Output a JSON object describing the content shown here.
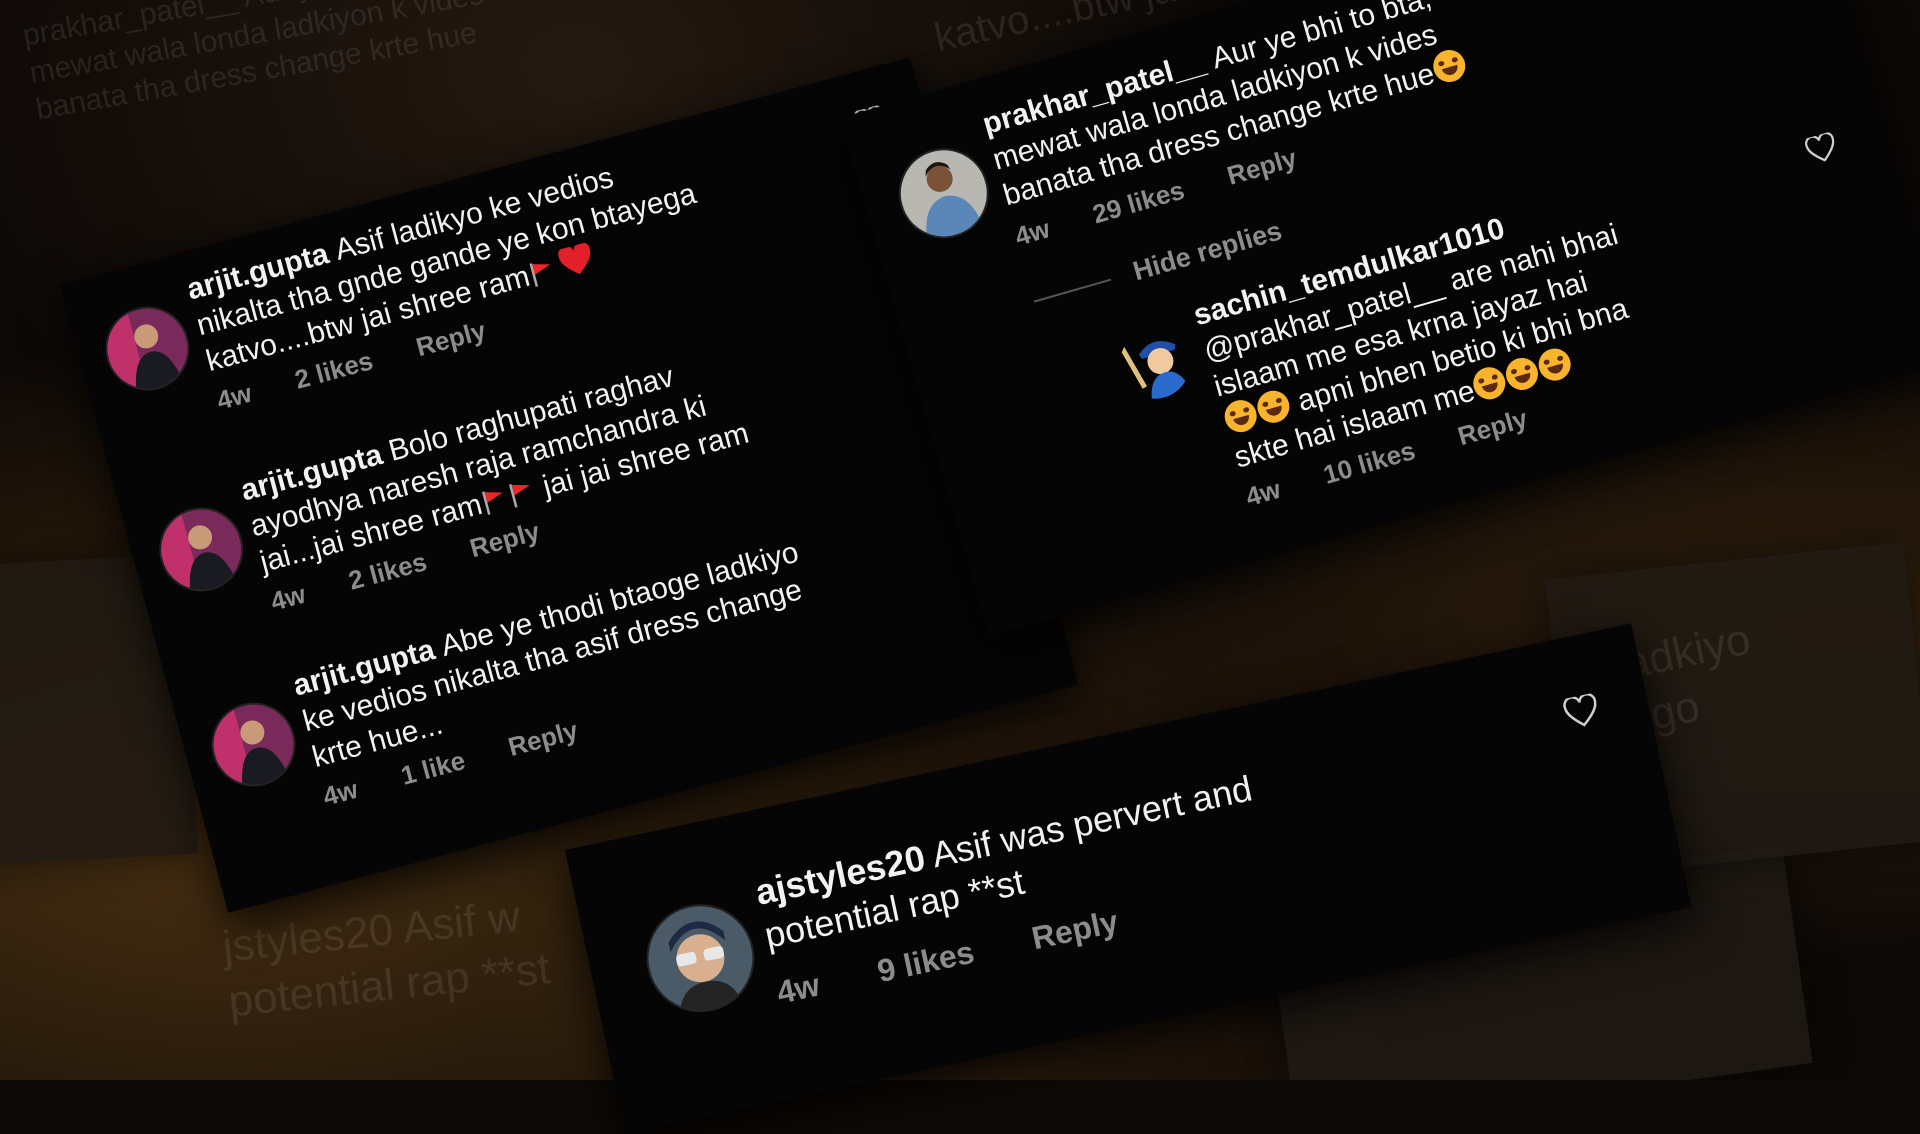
{
  "background": {
    "ghost_lines": [
      "prakhar_patel__ Aur ye bhi to bta,",
      "mewat wala londa ladkiyon k vides",
      "banata tha dress change krte hue",
      "katvo....btw jai shree ram",
      "ladkiyo",
      "ngo",
      "jstyles20 Asif w",
      "potential rap **st"
    ]
  },
  "colors": {
    "panel_bg": "#050505",
    "text": "#f2f2f2",
    "meta": "#8c8c8c",
    "flag_red": "#e8282b",
    "heart_red": "#e3202a",
    "emoji_yellow": "#f7b42c"
  },
  "panel_left": {
    "comments": [
      {
        "username": "arjit.gupta",
        "lines": [
          "Asif ladikyo ke vedios",
          "nikalta tha gnde gande ye kon btayega",
          "katvo....btw jai shree ram"
        ],
        "trailing_emoji": [
          "red-flag",
          "red-heart"
        ],
        "time": "4w",
        "likes": "2 likes",
        "reply": "Reply",
        "avatar_icon": "avatar-photo"
      },
      {
        "username": "arjit.gupta",
        "lines": [
          "Bolo raghupati raghav",
          "ayodhya naresh raja ramchandra ki",
          "jai...jai shree ram",
          "jai jai shree ram"
        ],
        "time": "4w",
        "likes": "2 likes",
        "reply": "Reply",
        "avatar_icon": "avatar-photo"
      },
      {
        "username": "arjit.gupta",
        "lines": [
          "Abe ye thodi btaoge ladkiyo",
          "ke vedios nikalta tha asif dress change",
          "krte hue..."
        ],
        "time": "4w",
        "likes": "1 like",
        "reply": "Reply",
        "avatar_icon": "avatar-photo"
      }
    ]
  },
  "panel_right": {
    "comment": {
      "username": "prakhar_patel__",
      "lines": [
        "Aur ye bhi to bta,",
        "mewat wala londa ladkiyon k vides",
        "banata tha dress change krte hue"
      ],
      "trailing_emoji": [
        "face-with-tears-of-joy"
      ],
      "time": "4w",
      "likes": "29 likes",
      "reply": "Reply"
    },
    "hide_replies": "Hide replies",
    "reply": {
      "username": "sachin_temdulkar1010",
      "lines": [
        "@prakhar_patel__ are nahi bhai",
        "islaam me esa krna jayaz hai",
        "apni bhen betio ki bhi bna",
        "skte hai islaam me"
      ],
      "emoji": [
        "winking-face-with-tongue",
        "rolling-on-floor-laughing"
      ],
      "time": "4w",
      "likes": "10 likes",
      "reply": "Reply",
      "avatar_icon": "cartoon-cricketer-avatar"
    }
  },
  "panel_bottom": {
    "comment": {
      "username": "ajstyles20",
      "lines": [
        "Asif was pervert and",
        "potential rap **st"
      ],
      "time": "4w",
      "likes": "9 likes",
      "reply": "Reply",
      "avatar_icon": "avatar-photo"
    }
  }
}
